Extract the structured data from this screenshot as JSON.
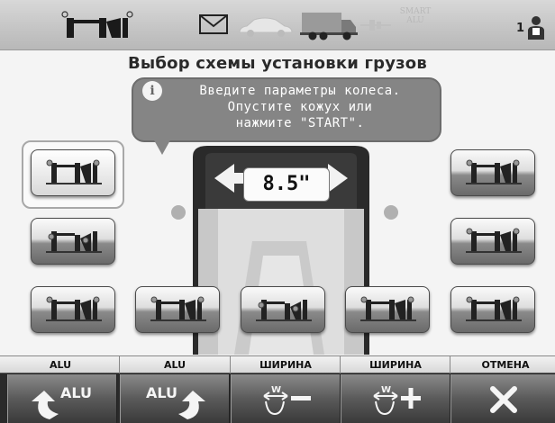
{
  "screen_title": "Выбор схемы установки грузов",
  "topbar": {
    "logo_icon": "balancer-logo-icon",
    "icons": [
      "envelope-icon",
      "car-icon",
      "truck-icon",
      "smart-alu-icon"
    ],
    "smart_label": "SMART\nALU",
    "user_number": "1"
  },
  "info": {
    "icon": "info-icon",
    "icon_text": "i",
    "lines": [
      "Введите параметры колеса.",
      "Опустите кожух или",
      "нажмите \"START\"."
    ]
  },
  "wheel": {
    "width_value": "8.5\""
  },
  "scheme_buttons": [
    {
      "name": "scheme-dyn",
      "selected": true
    },
    {
      "name": "scheme-alu1",
      "selected": false
    },
    {
      "name": "scheme-alu2",
      "selected": false
    },
    {
      "name": "scheme-alu3",
      "selected": false
    },
    {
      "name": "scheme-alu4",
      "selected": false
    },
    {
      "name": "scheme-alu5",
      "selected": false
    },
    {
      "name": "scheme-alu6",
      "selected": false
    },
    {
      "name": "scheme-alu7",
      "selected": false
    },
    {
      "name": "scheme-alu8",
      "selected": false
    }
  ],
  "function_keys": [
    {
      "label": "ALU",
      "icon": "alu-previous-icon",
      "icon_text": "ALU"
    },
    {
      "label": "ALU",
      "icon": "alu-next-icon",
      "icon_text": "ALU"
    },
    {
      "label": "ШИРИНА",
      "icon": "width-decrease-icon",
      "icon_text": "W"
    },
    {
      "label": "ШИРИНА",
      "icon": "width-increase-icon",
      "icon_text": "W"
    },
    {
      "label": "ОТМЕНА",
      "icon": "cancel-icon",
      "icon_text": ""
    }
  ],
  "colors": {
    "topbar": "#c8c8c8",
    "bubble": "#858585",
    "button_dark": "#5a5a5a",
    "background": "#f4f4f4"
  }
}
